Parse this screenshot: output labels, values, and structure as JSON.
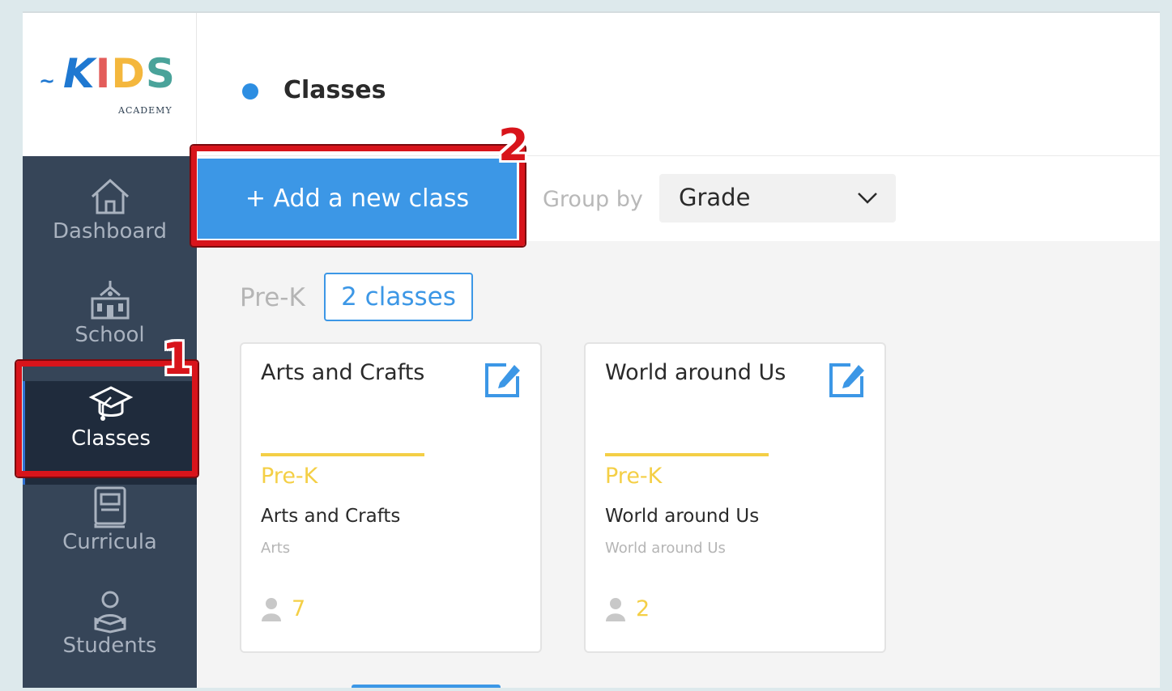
{
  "logo": {
    "wordmark": "KIDS",
    "subtitle": "ACADEMY",
    "letters": [
      "K",
      "I",
      "D",
      "S"
    ]
  },
  "sidebar": {
    "items": [
      {
        "label": "Dashboard",
        "icon": "home-icon",
        "active": false
      },
      {
        "label": "School",
        "icon": "school-building-icon",
        "active": false
      },
      {
        "label": "Classes",
        "icon": "graduation-cap-icon",
        "active": true
      },
      {
        "label": "Curricula",
        "icon": "book-icon",
        "active": false
      },
      {
        "label": "Students",
        "icon": "student-reading-icon",
        "active": false
      }
    ]
  },
  "header": {
    "title": "Classes"
  },
  "toolbar": {
    "add_button_label": "+ Add a new class",
    "group_by_label": "Group by",
    "group_by_value": "Grade"
  },
  "group": {
    "grade": "Pre-K",
    "count_label": "2 classes"
  },
  "cards": [
    {
      "title": "Arts and Crafts",
      "grade": "Pre-K",
      "name": "Arts and Crafts",
      "subject": "Arts",
      "students": "7"
    },
    {
      "title": "World around Us",
      "grade": "Pre-K",
      "name": "World around Us",
      "subject": "World around Us",
      "students": "2"
    }
  ],
  "annotations": {
    "step1": "1",
    "step2": "2"
  },
  "colors": {
    "accent": "#3c97e6",
    "sidebar_bg": "#364558",
    "sidebar_active_bg": "#1f2b3c",
    "grade_yellow": "#f4cf46",
    "annotation_red": "#d8141b"
  }
}
